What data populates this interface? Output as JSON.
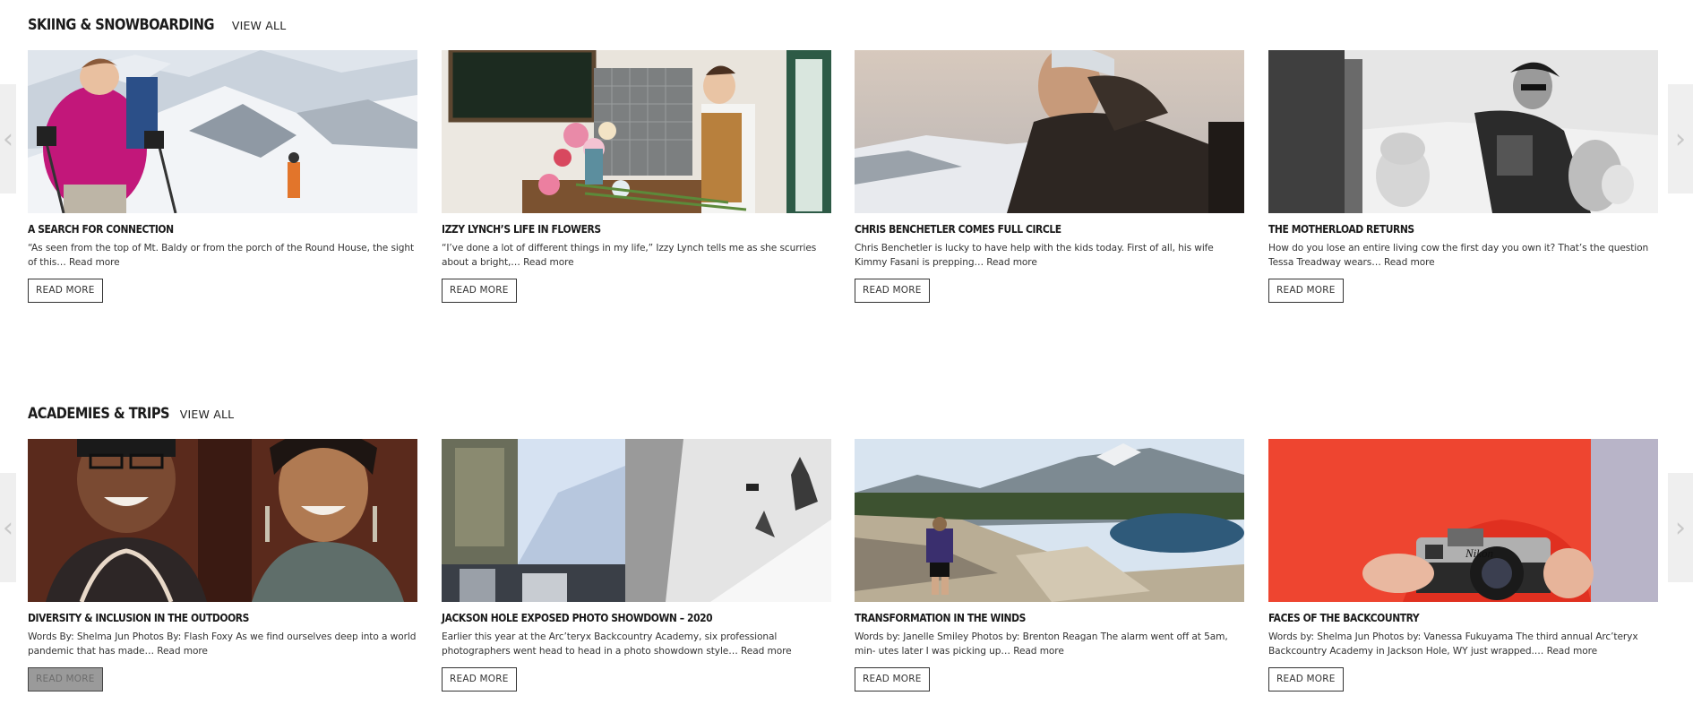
{
  "sections": [
    {
      "title": "SKIING & SNOWBOARDING",
      "view_all": "VIEW ALL",
      "prev_icon": "chevron-left-icon",
      "next_icon": "chevron-right-icon",
      "cards": [
        {
          "title": "A SEARCH FOR CONNECTION",
          "excerpt": "“As seen from the top of Mt. Baldy or from the porch of the Round House, the sight of this…",
          "read_more_link": "Read more",
          "button": "READ MORE",
          "image": "skier-in-pink-jacket-on-snowy-mountain"
        },
        {
          "title": "IZZY LYNCH’S LIFE IN FLOWERS",
          "excerpt": "“I’ve done a lot of different things in my life,” Izzy Lynch tells me as she scurries about a bright,…",
          "read_more_link": "Read more",
          "button": "READ MORE",
          "image": "florist-arranging-flowers"
        },
        {
          "title": "CHRIS BENCHETLER COMES FULL CIRCLE",
          "excerpt": "Chris Benchetler is lucky to have help with the kids today. First of all, his wife Kimmy Fasani is prepping…",
          "read_more_link": "Read more",
          "button": "READ MORE",
          "image": "man-in-dark-jacket-at-sunset"
        },
        {
          "title": "THE MOTHERLOAD RETURNS",
          "excerpt": "How do you lose an entire living cow the first day you own it? That’s the question Tessa Treadway wears…",
          "read_more_link": "Read more",
          "button": "READ MORE",
          "image": "family-in-snow-black-and-white"
        }
      ]
    },
    {
      "title": "ACADEMIES & TRIPS",
      "view_all": "VIEW ALL",
      "prev_icon": "chevron-left-icon",
      "next_icon": "chevron-right-icon",
      "cards": [
        {
          "title": "DIVERSITY & INCLUSION IN THE OUTDOORS",
          "excerpt": "Words By: Shelma Jun Photos By: Flash Foxy As we find ourselves deep into a world pandemic that has made…",
          "read_more_link": "Read more",
          "button": "READ MORE",
          "image": "two-smiling-women"
        },
        {
          "title": "JACKSON HOLE EXPOSED PHOTO SHOWDOWN – 2020",
          "excerpt": "Earlier this year at the Arc’teryx Backcountry Academy, six professional photographers went head to head in a photo showdown style…",
          "read_more_link": "Read more",
          "button": "READ MORE",
          "image": "snowboard-photo-collage"
        },
        {
          "title": "TRANSFORMATION IN THE WINDS",
          "excerpt": "Words by: Janelle Smiley Photos by: Brenton Reagan The alarm went off at 5am, min- utes later I was picking up…",
          "read_more_link": "Read more",
          "button": "READ MORE",
          "image": "hiker-on-rocky-alpine-trail"
        },
        {
          "title": "FACES OF THE BACKCOUNTRY",
          "excerpt": "Words by: Shelma Jun Photos by: Vanessa Fukuyama The third annual Arc’teryx Backcountry Academy in Jackson Hole, WY just wrapped.…",
          "read_more_link": "Read more",
          "button": "READ MORE",
          "image": "hands-holding-nikon-camera"
        }
      ]
    }
  ]
}
